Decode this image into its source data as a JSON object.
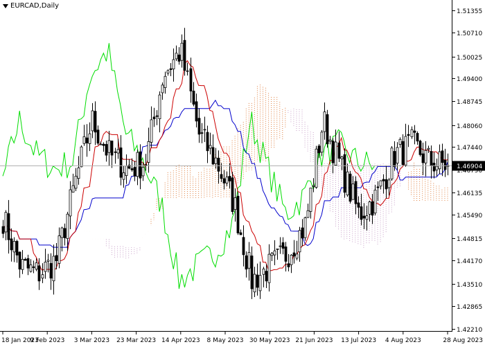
{
  "header": {
    "title": "EURCAD,Daily"
  },
  "colors": {
    "background": "#ffffff",
    "candles": "#000000",
    "tenkan": "#cc0000",
    "kijun": "#0000cc",
    "chikou": "#00dd00",
    "kumo_bull": "#e08040",
    "kumo_bear": "#c8a0c8",
    "current_price_line": "#b0b0b0"
  },
  "chart_data": {
    "type": "candlestick",
    "symbol": "EURCAD",
    "timeframe": "Daily",
    "indicator": "Ichimoku Kinko Hyo",
    "y_ticks": [
      1.51355,
      1.5071,
      1.50025,
      1.494,
      1.48745,
      1.4806,
      1.4744,
      1.4679,
      1.46135,
      1.4549,
      1.44815,
      1.4417,
      1.4351,
      1.42865,
      1.4221
    ],
    "current_price": "1.46904",
    "ylim": [
      1.4221,
      1.51355
    ],
    "x_tick_labels": [
      "18 Jan 2023",
      "9 Feb 2023",
      "3 Mar 2023",
      "23 Mar 2023",
      "14 Apr 2023",
      "8 May 2023",
      "30 May 2023",
      "21 Jun 2023",
      "13 Jul 2023",
      "4 Aug 2023",
      "28 Aug 2023"
    ],
    "approx_close_path": [
      {
        "date": "18 Jan 2023",
        "price": 1.454
      },
      {
        "date": "1 Feb 2023",
        "price": 1.44
      },
      {
        "date": "9 Feb 2023",
        "price": 1.438
      },
      {
        "date": "20 Feb 2023",
        "price": 1.442
      },
      {
        "date": "3 Mar 2023",
        "price": 1.463
      },
      {
        "date": "10 Mar 2023",
        "price": 1.482
      },
      {
        "date": "17 Mar 2023",
        "price": 1.472
      },
      {
        "date": "23 Mar 2023",
        "price": 1.468
      },
      {
        "date": "3 Apr 2023",
        "price": 1.47
      },
      {
        "date": "14 Apr 2023",
        "price": 1.495
      },
      {
        "date": "24 Apr 2023",
        "price": 1.502
      },
      {
        "date": "1 May 2023",
        "price": 1.478
      },
      {
        "date": "8 May 2023",
        "price": 1.47
      },
      {
        "date": "18 May 2023",
        "price": 1.458
      },
      {
        "date": "30 May 2023",
        "price": 1.436
      },
      {
        "date": "9 Jun 2023",
        "price": 1.44
      },
      {
        "date": "21 Jun 2023",
        "price": 1.444
      },
      {
        "date": "30 Jun 2023",
        "price": 1.452
      },
      {
        "date": "7 Jul 2023",
        "price": 1.482
      },
      {
        "date": "13 Jul 2023",
        "price": 1.468
      },
      {
        "date": "21 Jul 2023",
        "price": 1.455
      },
      {
        "date": "27 Jul 2023",
        "price": 1.46
      },
      {
        "date": "4 Aug 2023",
        "price": 1.472
      },
      {
        "date": "14 Aug 2023",
        "price": 1.475
      },
      {
        "date": "22 Aug 2023",
        "price": 1.47
      },
      {
        "date": "28 Aug 2023",
        "price": 1.46904
      }
    ]
  }
}
